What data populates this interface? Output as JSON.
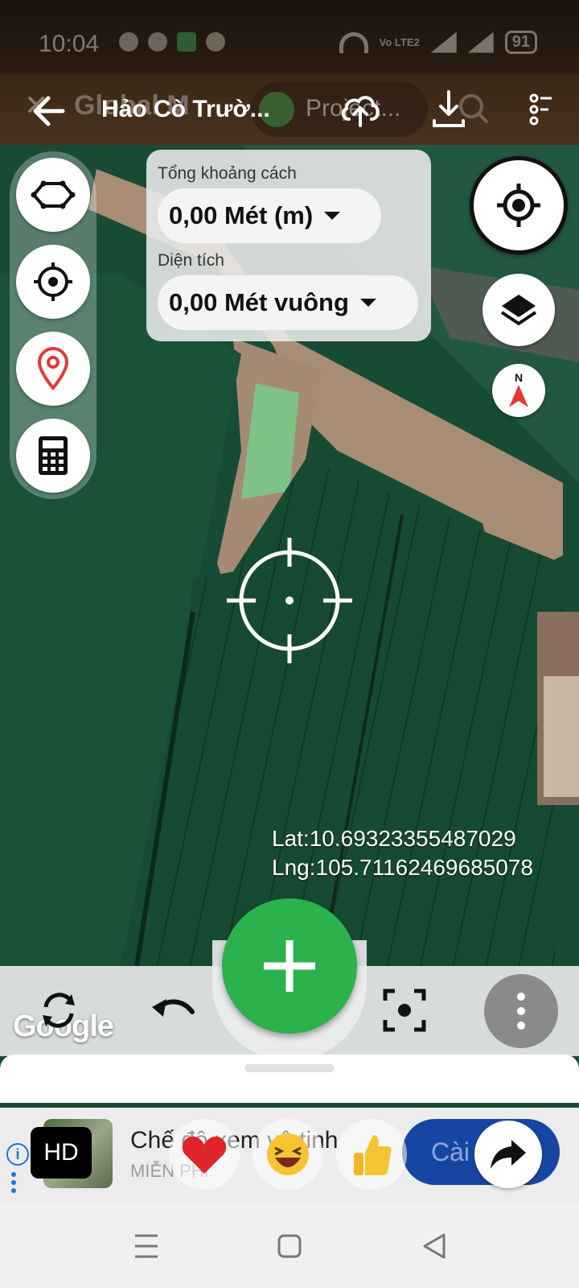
{
  "status_bar": {
    "time": "10:04",
    "network": "Vo LTE2",
    "battery": "91"
  },
  "app_bar": {
    "ghost_title": "Global M",
    "title": "Hảo Cò Trườ...",
    "project_label": "Project..."
  },
  "map_tools": {
    "shape_tool": "polygon-icon",
    "target_tool": "crosshair-icon",
    "marker_tool": "map-pin-icon",
    "calculator_tool": "calculator-icon"
  },
  "measure": {
    "distance_label": "Tổng khoảng cách",
    "distance_value": "0,00 Mét (m)",
    "area_label": "Diện tích",
    "area_value": "0,00 Mét vuông"
  },
  "coords": {
    "lat": "Lat:10.69323355487029",
    "lng": "Lng:105.71162469685078"
  },
  "map_attribution": "Google",
  "ad": {
    "badge": "HD",
    "title": "Chế độ xem vệ tinh",
    "subtitle": "MIỄN PHÍ",
    "install_label": "Cài"
  },
  "colors": {
    "accent_green": "#2bb24c",
    "install_blue": "#1746a2",
    "pin_red": "#e53935"
  }
}
